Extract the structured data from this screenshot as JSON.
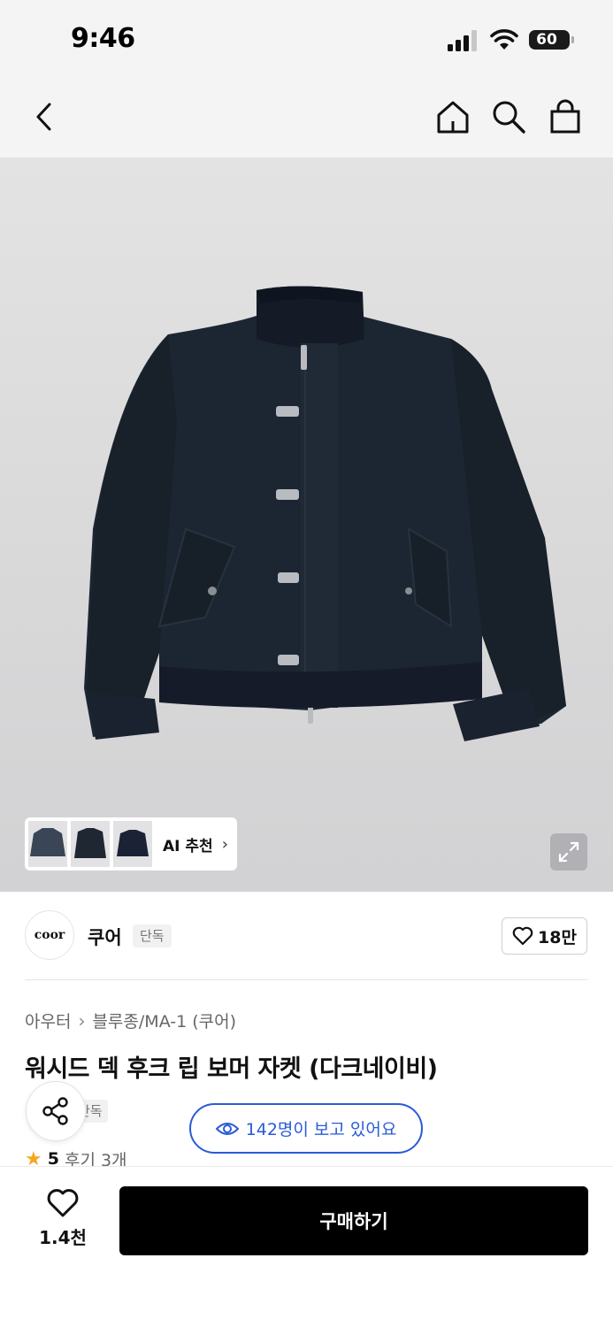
{
  "status_bar": {
    "time": "9:46",
    "battery": "60"
  },
  "nav": {
    "icons": [
      "back-icon",
      "home-icon",
      "search-icon",
      "shopping-bag-icon"
    ]
  },
  "hero": {
    "thumbnail_count": 3,
    "ai_recommend_label": "AI 추천",
    "expand_icon": "expand-icon"
  },
  "brand": {
    "logo_text": "coor",
    "name": "쿠어",
    "badge": "단독",
    "like_count": "18만"
  },
  "product": {
    "breadcrumb": [
      "아우터",
      "블루종/MA-1 (쿠어)"
    ],
    "title": "워시드 덱 후크 립 보머 자켓 (다크네이비)",
    "exclusive_tag": "단독",
    "viewers_text": "142명이 보고 있어요",
    "rating": "5",
    "review_text": "후기 3개"
  },
  "bottom_bar": {
    "wish_count": "1.4천",
    "buy_label": "구매하기"
  },
  "colors": {
    "accent_blue": "#2a5bd7",
    "star": "#f5a623",
    "buy_button": "#000000"
  }
}
